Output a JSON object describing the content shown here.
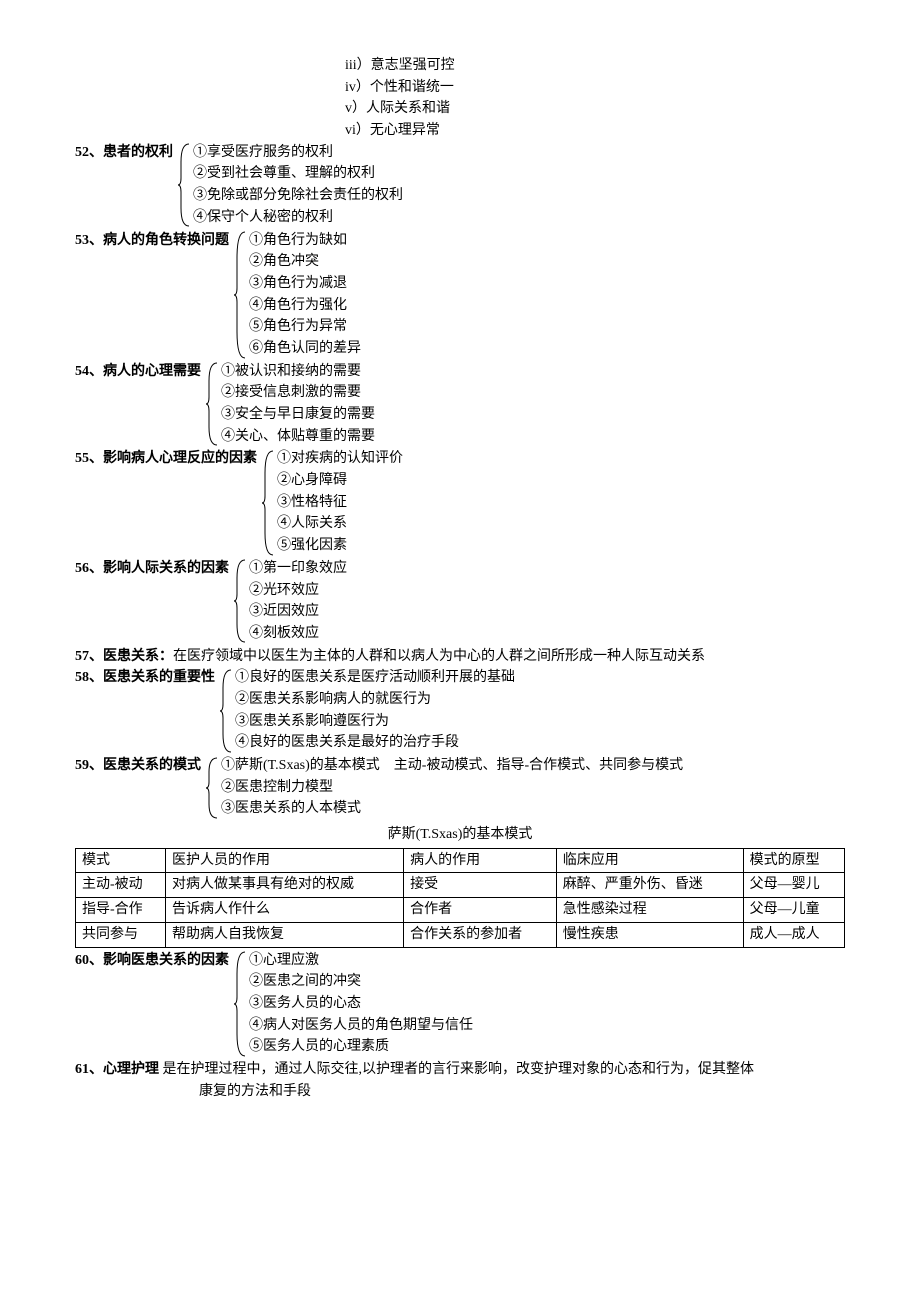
{
  "pre_lines": {
    "l1": "iii）意志坚强可控",
    "l2": "iv）个性和谐统一",
    "l3": "v）人际关系和谐",
    "l4": "vi）无心理异常"
  },
  "i52": {
    "num": "52、",
    "title": "患者的权利",
    "l1": "①享受医疗服务的权利",
    "l2": "②受到社会尊重、理解的权利",
    "l3": "③免除或部分免除社会责任的权利",
    "l4": "④保守个人秘密的权利"
  },
  "i53": {
    "num": "53、",
    "title": "病人的角色转换问题",
    "l1": "①角色行为缺如",
    "l2": "②角色冲突",
    "l3": "③角色行为减退",
    "l4": "④角色行为强化",
    "l5": "⑤角色行为异常",
    "l6": "⑥角色认同的差异"
  },
  "i54": {
    "num": "54、",
    "title": "病人的心理需要",
    "l1": "①被认识和接纳的需要",
    "l2": "②接受信息刺激的需要",
    "l3": "③安全与早日康复的需要",
    "l4": "④关心、体贴尊重的需要"
  },
  "i55": {
    "num": "55、",
    "title": "影响病人心理反应的因素",
    "l1": "①对疾病的认知评价",
    "l2": "②心身障碍",
    "l3": "③性格特征",
    "l4": "④人际关系",
    "l5": "⑤强化因素"
  },
  "i56": {
    "num": "56、",
    "title": "影响人际关系的因素",
    "l1": "①第一印象效应",
    "l2": "②光环效应",
    "l3": "③近因效应",
    "l4": "④刻板效应"
  },
  "i57": {
    "num": "57、",
    "title": "医患关系：",
    "def": "在医疗领域中以医生为主体的人群和以病人为中心的人群之间所形成一种人际互动关系"
  },
  "i58": {
    "num": "58、",
    "title": "医患关系的重要性",
    "l1": "①良好的医患关系是医疗活动顺利开展的基础",
    "l2": "②医患关系影响病人的就医行为",
    "l3": "③医患关系影响遵医行为",
    "l4": "④良好的医患关系是最好的治疗手段"
  },
  "i59": {
    "num": "59、",
    "title": "医患关系的模式",
    "l1": "①萨斯(T.Sxas)的基本模式　主动-被动模式、指导-合作模式、共同参与模式",
    "l2": "②医患控制力模型",
    "l3": "③医患关系的人本模式"
  },
  "table_title": "萨斯(T.Sxas)的基本模式",
  "table": {
    "h1": "模式",
    "h2": "医护人员的作用",
    "h3": "病人的作用",
    "h4": "临床应用",
    "h5": "模式的原型",
    "r1c1": "主动-被动",
    "r1c2": "对病人做某事具有绝对的权威",
    "r1c3": "接受",
    "r1c4": "麻醉、严重外伤、昏迷",
    "r1c5": "父母—婴儿",
    "r2c1": "指导-合作",
    "r2c2": "告诉病人作什么",
    "r2c3": "合作者",
    "r2c4": "急性感染过程",
    "r2c5": "父母—儿童",
    "r3c1": "共同参与",
    "r3c2": "帮助病人自我恢复",
    "r3c3": "合作关系的参加者",
    "r3c4": "慢性疾患",
    "r3c5": "成人—成人"
  },
  "i60": {
    "num": "60、",
    "title": "影响医患关系的因素",
    "l1": "①心理应激",
    "l2": "②医患之间的冲突",
    "l3": "③医务人员的心态",
    "l4": "④病人对医务人员的角色期望与信任",
    "l5": "⑤医务人员的心理素质"
  },
  "i61": {
    "num": "61、",
    "title": "心理护理",
    "def1": " 是在护理过程中，通过人际交往,以护理者的言行来影响，改变护理对象的心态和行为，促其整体",
    "def2": "康复的方法和手段"
  }
}
